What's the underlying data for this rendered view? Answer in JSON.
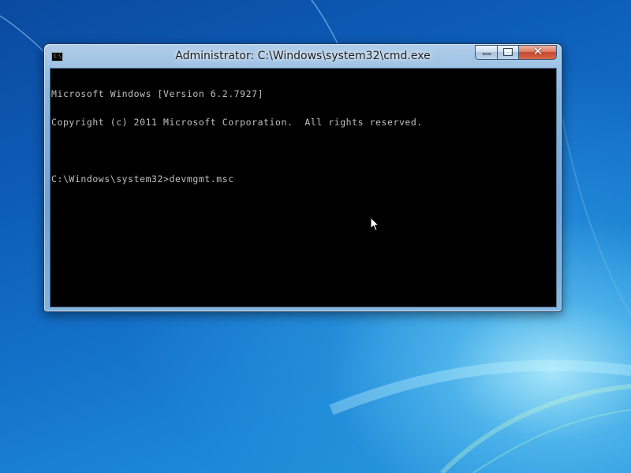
{
  "window": {
    "title": "Administrator: C:\\Windows\\system32\\cmd.exe",
    "icon": "console-icon",
    "controls": {
      "minimize_icon": "minimize-icon",
      "maximize_icon": "maximize-icon",
      "close_icon": "close-icon",
      "close_glyph": "✕"
    }
  },
  "console": {
    "background": "#000000",
    "foreground": "#c0c0c0",
    "lines": [
      "Microsoft Windows [Version 6.2.7927]",
      "Copyright (c) 2011 Microsoft Corporation.  All rights reserved.",
      "",
      "C:\\Windows\\system32>devmgmt.msc"
    ]
  },
  "desktop": {
    "accent": "#1472c9",
    "cursor_icon": "arrow-cursor-icon"
  }
}
